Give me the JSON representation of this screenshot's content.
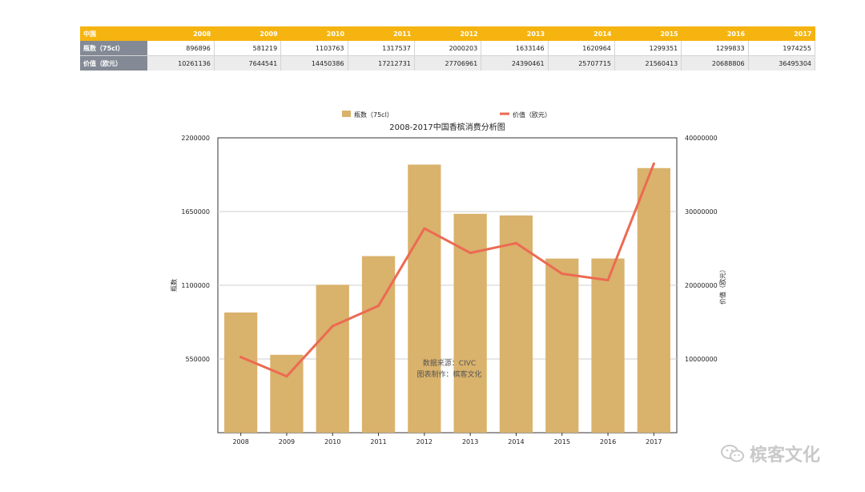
{
  "table": {
    "header_label": "中国",
    "years": [
      "2008",
      "2009",
      "2010",
      "2011",
      "2012",
      "2013",
      "2014",
      "2015",
      "2016",
      "2017"
    ],
    "rows": [
      {
        "label": "瓶数（75cl）",
        "values": [
          "896896",
          "581219",
          "1103763",
          "1317537",
          "2000203",
          "1633146",
          "1620964",
          "1299351",
          "1299833",
          "1974255"
        ]
      },
      {
        "label": "价值（欧元）",
        "values": [
          "10261136",
          "7644541",
          "14450386",
          "17212731",
          "27706961",
          "24390461",
          "25707715",
          "21560413",
          "20688806",
          "36495304"
        ]
      }
    ]
  },
  "chart_data": {
    "type": "bar",
    "title": "2008-2017中国香槟消费分析图",
    "categories": [
      "2008",
      "2009",
      "2010",
      "2011",
      "2012",
      "2013",
      "2014",
      "2015",
      "2016",
      "2017"
    ],
    "series": [
      {
        "name": "瓶数（75cl）",
        "type": "bar",
        "axis": "left",
        "color": "#d9b26c",
        "values": [
          896896,
          581219,
          1103763,
          1317537,
          2000203,
          1633146,
          1620964,
          1299351,
          1299833,
          1974255
        ]
      },
      {
        "name": "价值（欧元）",
        "type": "line",
        "axis": "right",
        "color": "#ec6a52",
        "values": [
          10261136,
          7644541,
          14450386,
          17212731,
          27706961,
          24390461,
          25707715,
          21560413,
          20688806,
          36495304
        ]
      }
    ],
    "ylabel_left": "瓶数",
    "ylabel_right": "价值（欧元）",
    "ylim_left": [
      0,
      2200000
    ],
    "yticks_left": [
      "550000",
      "1100000",
      "1650000",
      "2200000"
    ],
    "ylim_right": [
      0,
      40000000
    ],
    "yticks_right": [
      "10000000",
      "20000000",
      "30000000",
      "40000000"
    ],
    "legend_position": "top-center",
    "grid": true,
    "annotations": [
      "数据来源：CIVC",
      "图表制作：槟客文化"
    ]
  },
  "watermark": {
    "text": "槟客文化",
    "icon": "wechat-icon"
  }
}
